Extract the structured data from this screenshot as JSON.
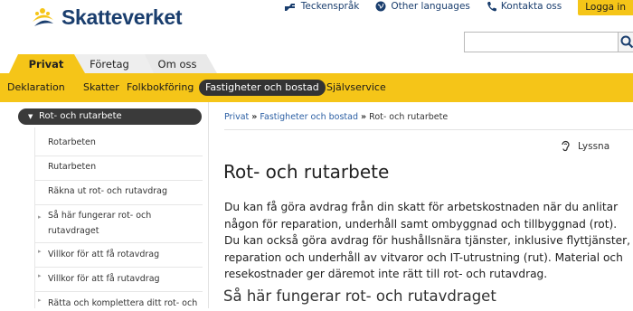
{
  "brand": {
    "name": "Skatteverket"
  },
  "toplinks": {
    "sign": "Teckenspråk",
    "languages": "Other languages",
    "contact": "Kontakta oss",
    "login": "Logga in"
  },
  "search": {
    "placeholder": ""
  },
  "tabs": [
    {
      "label": "Privat"
    },
    {
      "label": "Företag"
    },
    {
      "label": "Om oss"
    }
  ],
  "nav": [
    {
      "label": "Deklaration"
    },
    {
      "label": "Skatter"
    },
    {
      "label": "Folkbokföring"
    },
    {
      "label": "Fastigheter och bostad"
    },
    {
      "label": "Självservice"
    }
  ],
  "sidebar": {
    "header": "Rot- och rutarbete",
    "items": [
      {
        "label": "Rotarbeten"
      },
      {
        "label": "Rutarbeten"
      },
      {
        "label": "Räkna ut rot- och rutavdrag"
      },
      {
        "label1": "Så här fungerar rot- och",
        "label2": "rutavdraget"
      },
      {
        "label": "Villkor för att få rotavdrag"
      },
      {
        "label": "Villkor för att få rutavdrag"
      },
      {
        "label": "Rätta och komplettera ditt rot- och"
      }
    ]
  },
  "breadcrumb": {
    "home": "Privat",
    "section": "Fastigheter och bostad",
    "current": "Rot- och rutarbete",
    "separator": "»"
  },
  "listen": "Lyssna",
  "main": {
    "title": "Rot- och rutarbete",
    "intro": "Du kan få göra avdrag från din skatt för arbetskostnaden när du anlitar någon för reparation, underhåll samt ombyggnad och tillbyggnad (rot). Du kan också göra avdrag för hushållsnära tjänster, inklusive flyttjänster, reparation och underhåll av vitvaror och IT-utrustning (rut). Material och resekostnader ger däremot inte rätt till rot- och rutavdrag.",
    "subheading": "Så här fungerar rot- och rutavdraget"
  },
  "colors": {
    "accent": "#f5c518",
    "brand": "#1a3e6e",
    "link": "#2a5ea3"
  }
}
